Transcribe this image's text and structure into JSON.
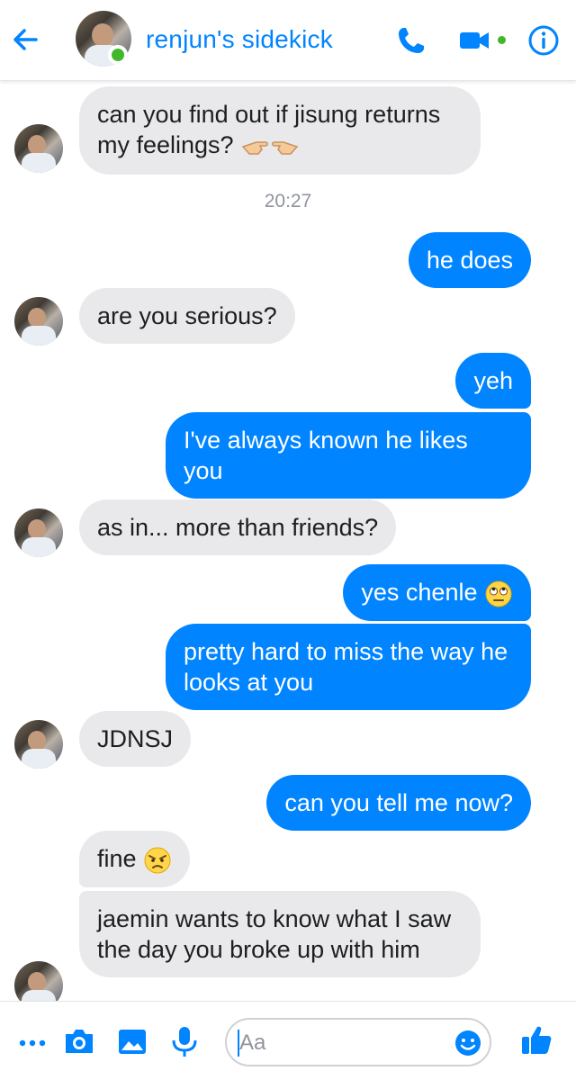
{
  "header": {
    "title": "renjun's sidekick",
    "back_icon": "arrow-left-icon",
    "icons": [
      "phone-icon",
      "video-camera-icon",
      "info-icon"
    ],
    "accent": "#0084ff",
    "online_color": "#42b72a"
  },
  "timestamp": "20:27",
  "messages": [
    {
      "from": "them",
      "text": "can you find out if jisung returns my feelings?",
      "emoji": "pointing-hands-emoji"
    },
    {
      "from": "me",
      "text": "he does"
    },
    {
      "from": "them",
      "text": "are you serious?"
    },
    {
      "from": "me",
      "text": "yeh"
    },
    {
      "from": "me",
      "text": "I've always known he likes you"
    },
    {
      "from": "them",
      "text": "as in... more than friends?"
    },
    {
      "from": "me",
      "text": "yes chenle",
      "emoji": "eye-roll-emoji"
    },
    {
      "from": "me",
      "text": "pretty hard to miss the way he looks at you"
    },
    {
      "from": "them",
      "text": "JDNSJ"
    },
    {
      "from": "me",
      "text": "can you tell me now?"
    },
    {
      "from": "them",
      "text": "fine",
      "emoji": "angry-face-emoji"
    },
    {
      "from": "them",
      "text": "jaemin wants to know what I saw the day you broke up with him"
    }
  ],
  "composer": {
    "placeholder": "Aa",
    "icons": [
      "more-dots-icon",
      "camera-icon",
      "image-icon",
      "microphone-icon",
      "smiley-icon",
      "thumbs-up-icon"
    ]
  },
  "colors": {
    "outgoing_bubble": "#0084ff",
    "incoming_bubble": "#e9e9eb",
    "timestamp": "#90949c"
  }
}
